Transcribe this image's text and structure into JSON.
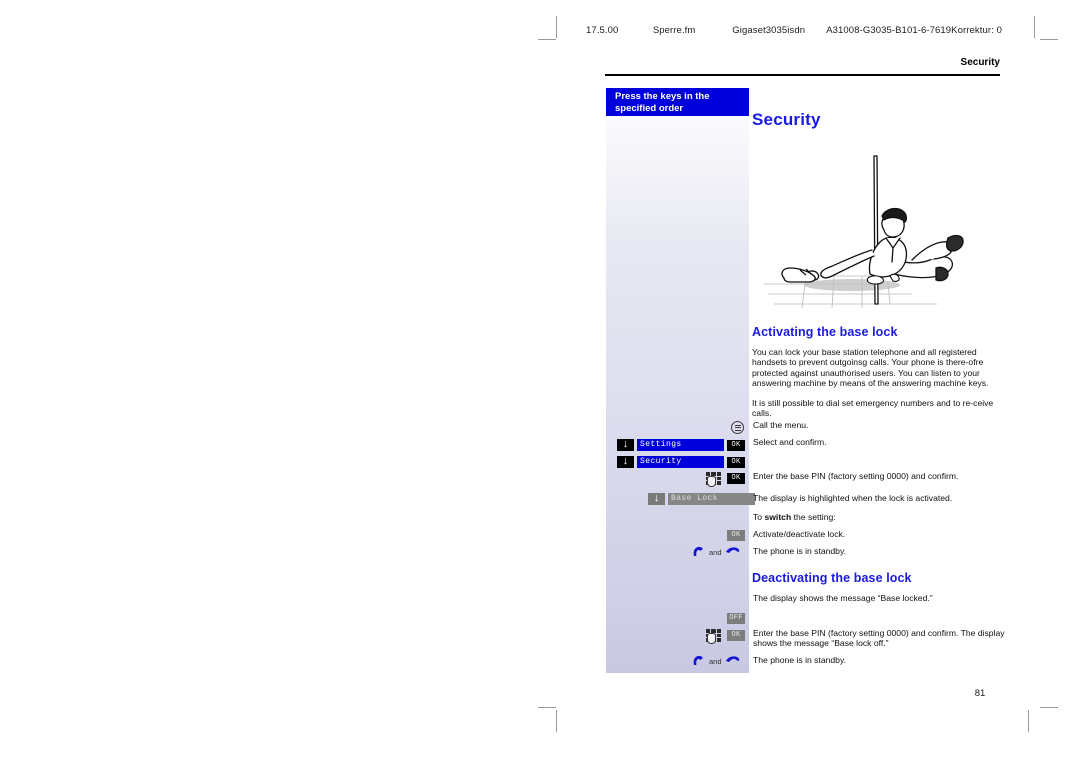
{
  "doc_header": {
    "date": "17.5.00",
    "file": "Sperre.fm",
    "product": "Gigaset3035isdn",
    "code": "A31008-G3035-B101-6-7619",
    "korrektur": "Korrektur: 0"
  },
  "running_head": "Security",
  "chapter_title": "Security",
  "margin_banner": "Press the keys in the specified order",
  "sections": {
    "activate": {
      "title": "Activating the base lock",
      "intro": "You can lock your base station telephone and all registered handsets to prevent outgoinsg calls. Your phone is there-ofre protected against unauthorised users. You can listen to your answering machine by means of the answering machine keys.",
      "emergency": "It is still possible to dial set emergency numbers and to re-ceive calls."
    },
    "deactivate": {
      "title": "Deactivating the base lock"
    }
  },
  "steps_activate": [
    {
      "icon": "menu-icon",
      "text": "Call the menu."
    },
    {
      "icon": "arrow-down-key",
      "display": "Settings",
      "display_state": "highlighted",
      "key": "OK",
      "key_state": "black",
      "text": "Select and confirm."
    },
    {
      "icon": "arrow-down-key",
      "display": "Security",
      "display_state": "highlighted",
      "key": "OK",
      "key_state": "black",
      "text": ""
    },
    {
      "icon": "keypad-icon",
      "key": "OK",
      "key_state": "black",
      "text": "Enter the base PIN (factory setting 0000) and confirm."
    },
    {
      "icon": "arrow-down-key-grey",
      "display": "Base Lock",
      "display_state": "grey",
      "text": "The display is highlighted when the lock is activated."
    },
    {
      "text_prefix": "To ",
      "text_bold": "switch",
      "text_suffix": " the setting:"
    },
    {
      "key": "OK",
      "key_state": "grey",
      "text": "Activate/deactivate lock."
    },
    {
      "icon": "handset-pair",
      "conjunction": "and",
      "text": "The phone is in standby."
    }
  ],
  "steps_deactivate": [
    {
      "text": "The display shows the message “Base locked.”"
    },
    {
      "key": "OFF",
      "key_state": "grey"
    },
    {
      "icon": "keypad-icon",
      "key": "OK",
      "key_state": "grey",
      "text": "Enter the base PIN (factory setting 0000) and confirm. The display shows the message “Base lock off.”"
    },
    {
      "icon": "handset-pair",
      "conjunction": "and",
      "text": "The phone is in standby."
    }
  ],
  "page_number": "81",
  "colors": {
    "accent_blue": "#1919e6",
    "banner_blue": "#0000dd",
    "display_blue": "#0000dd",
    "grey_key": "#7d7d7d"
  }
}
